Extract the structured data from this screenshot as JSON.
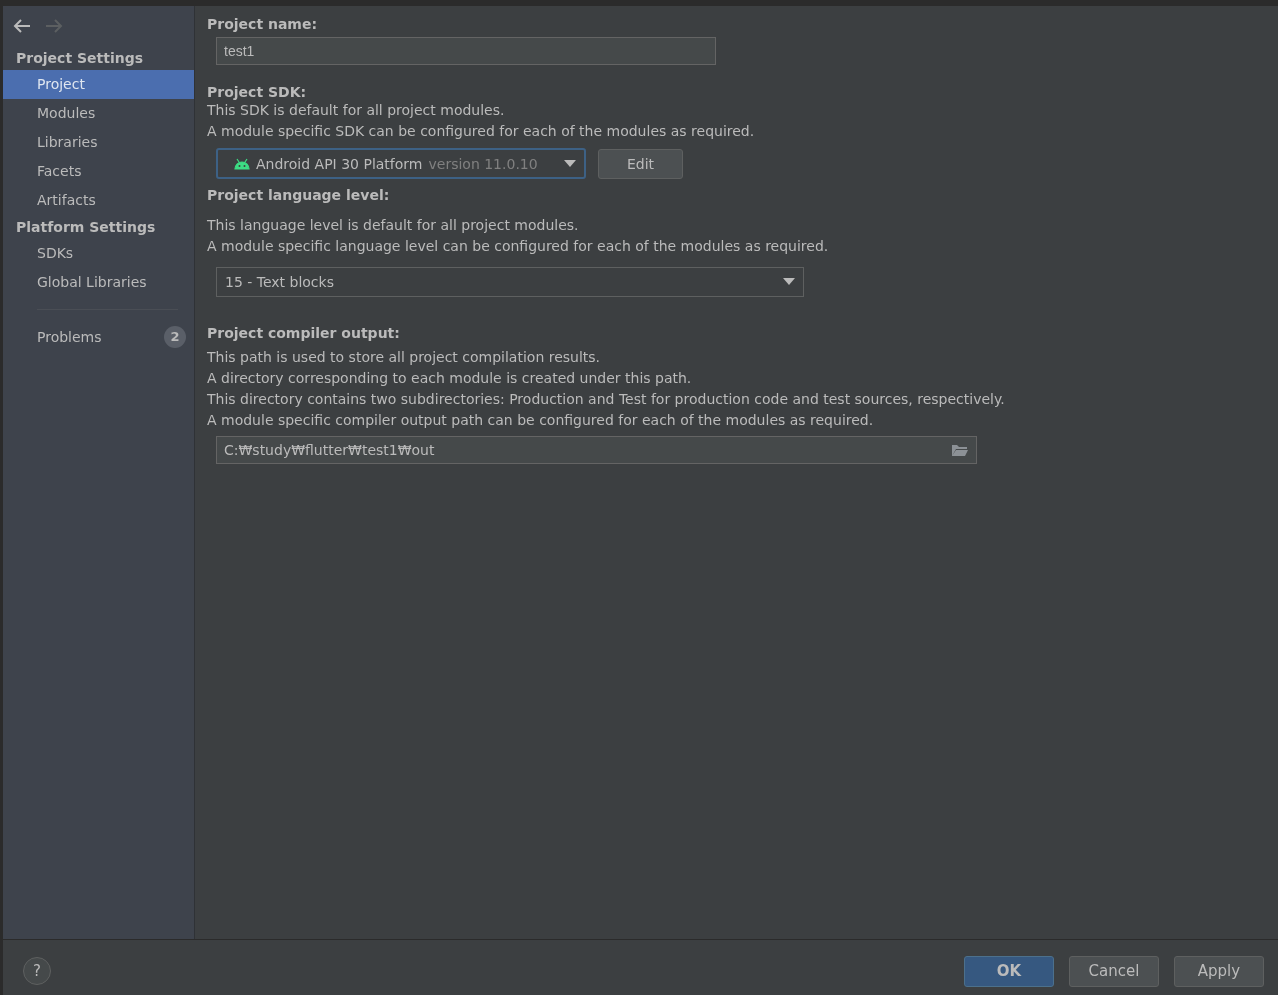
{
  "sidebar": {
    "back_enabled": true,
    "forward_enabled": false,
    "sections": [
      {
        "title": "Project Settings",
        "items": [
          {
            "label": "Project",
            "selected": true
          },
          {
            "label": "Modules",
            "selected": false
          },
          {
            "label": "Libraries",
            "selected": false
          },
          {
            "label": "Facets",
            "selected": false
          },
          {
            "label": "Artifacts",
            "selected": false
          }
        ]
      },
      {
        "title": "Platform Settings",
        "items": [
          {
            "label": "SDKs",
            "selected": false
          },
          {
            "label": "Global Libraries",
            "selected": false
          }
        ]
      }
    ],
    "problems": {
      "label": "Problems",
      "count": "2",
      "selected": false
    }
  },
  "project_name": {
    "label": "Project name:",
    "value": "test1"
  },
  "project_sdk": {
    "label": "Project SDK:",
    "description": [
      "This SDK is default for all project modules.",
      "A module specific SDK can be configured for each of the modules as required."
    ],
    "value": "Android API 30 Platform",
    "version": "version 11.0.10",
    "edit_button": "Edit"
  },
  "language_level": {
    "label": "Project language level:",
    "description": [
      "This language level is default for all project modules.",
      "A module specific language level can be configured for each of the modules as required."
    ],
    "value": "15 - Text blocks"
  },
  "compiler_output": {
    "label": "Project compiler output:",
    "description": [
      "This path is used to store all project compilation results.",
      "A directory corresponding to each module is created under this path.",
      "This directory contains two subdirectories: Production and Test for production code and test sources, respectively.",
      "A module specific compiler output path can be configured for each of the modules as required."
    ],
    "value": "C:₩study₩flutter₩test1₩out"
  },
  "buttons": [
    {
      "label": "OK",
      "kind": "primary"
    },
    {
      "label": "Cancel",
      "kind": "normal"
    },
    {
      "label": "Apply",
      "kind": "normal"
    }
  ],
  "help_button": "?"
}
